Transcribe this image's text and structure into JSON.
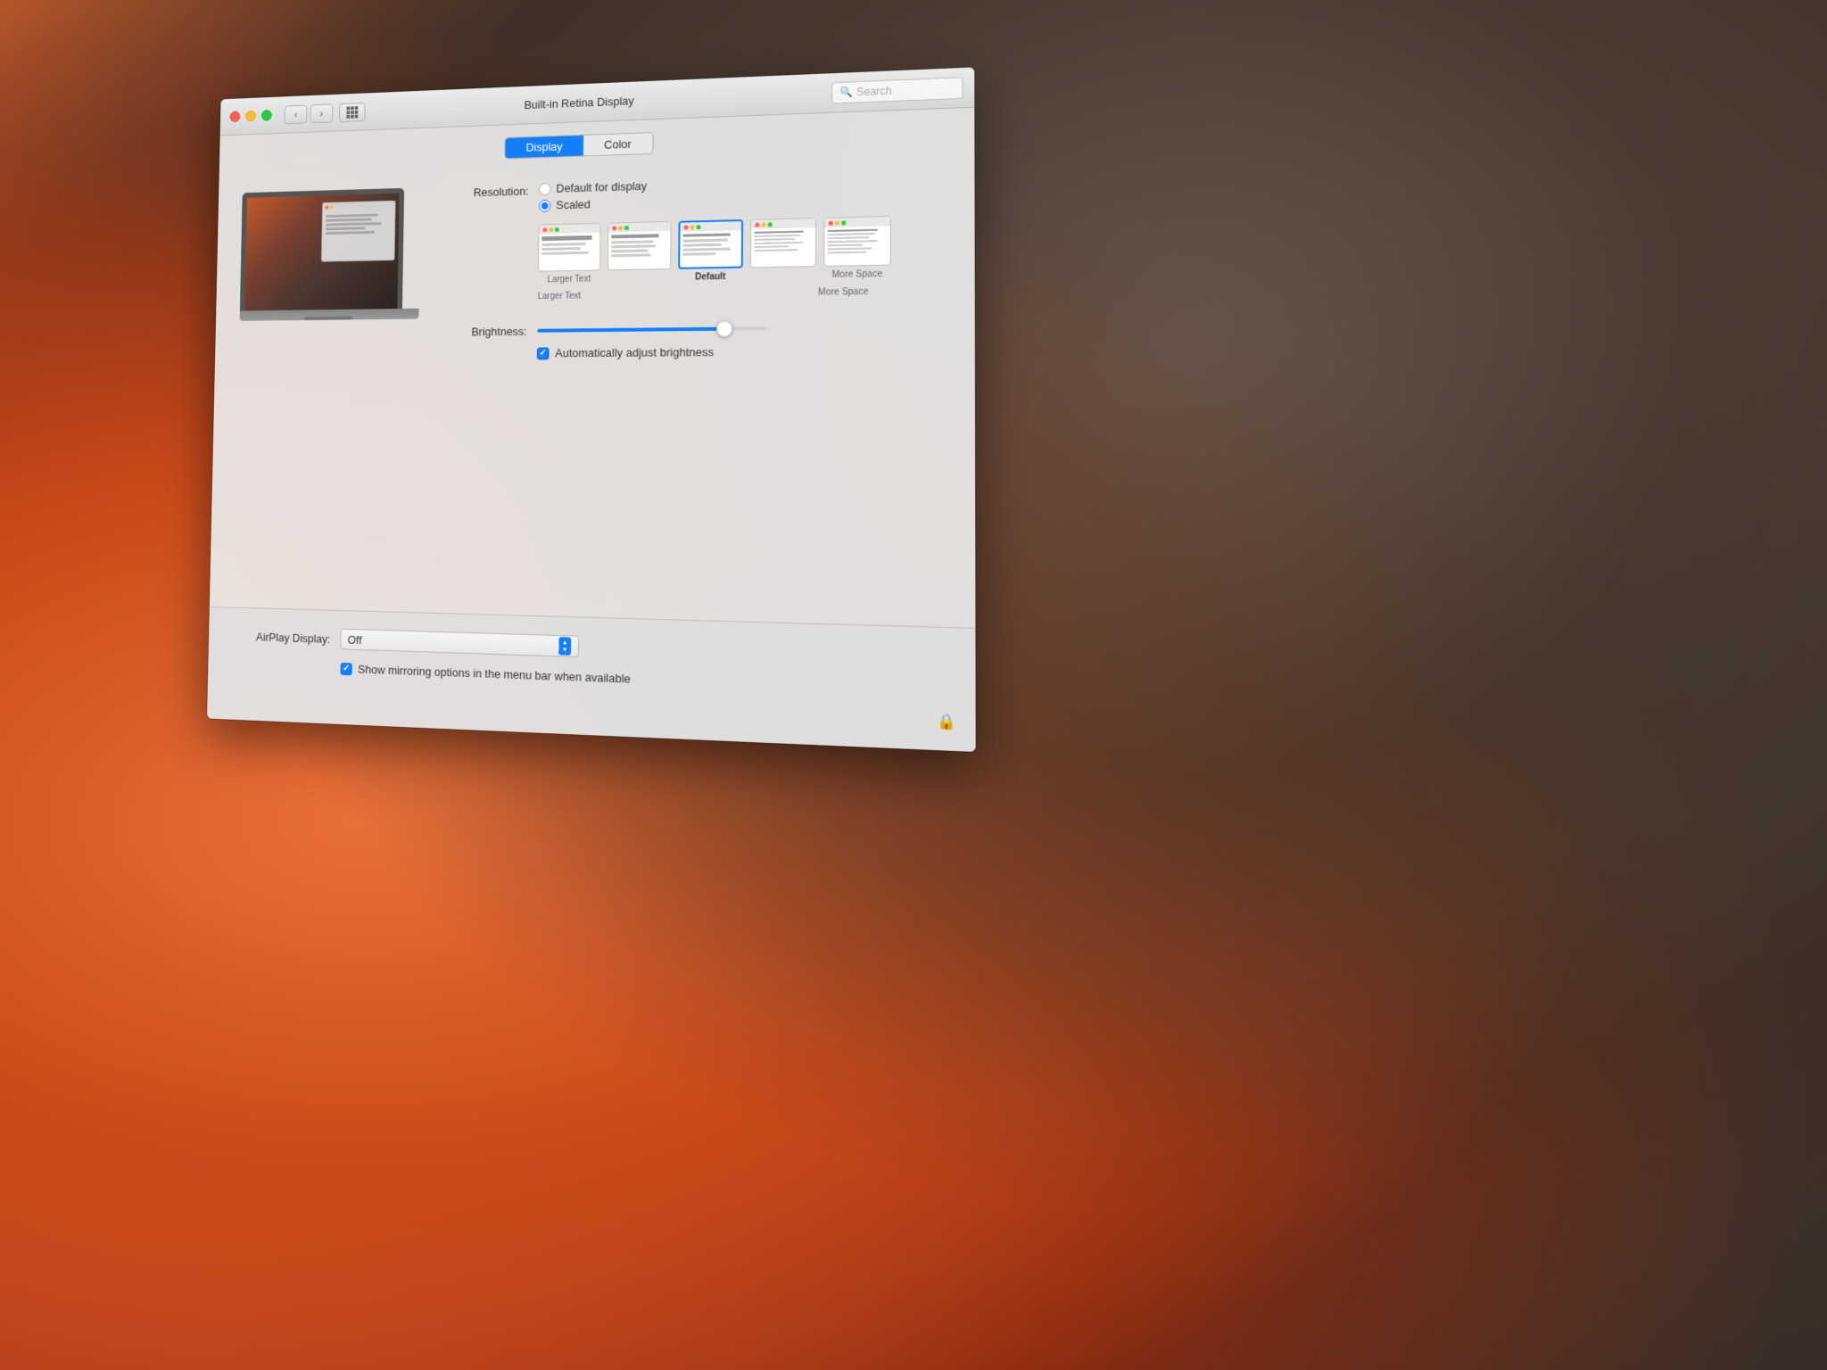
{
  "background": {
    "description": "macOS Yosemite El Capitan wallpaper"
  },
  "window": {
    "title": "Built-in Retina Display",
    "search_placeholder": "Search"
  },
  "tabs": {
    "items": [
      {
        "id": "display",
        "label": "Display",
        "active": true
      },
      {
        "id": "color",
        "label": "Color",
        "active": false
      }
    ]
  },
  "resolution": {
    "label": "Resolution:",
    "options": [
      {
        "id": "default",
        "label": "Default for display",
        "selected": false
      },
      {
        "id": "scaled",
        "label": "Scaled",
        "selected": true
      }
    ]
  },
  "scale_options": [
    {
      "id": "larger-text",
      "label": "Larger Text",
      "selected": false,
      "bold": false
    },
    {
      "id": "option2",
      "label": "",
      "selected": false,
      "bold": false
    },
    {
      "id": "default",
      "label": "Default",
      "selected": true,
      "bold": true
    },
    {
      "id": "option4",
      "label": "",
      "selected": false,
      "bold": false
    },
    {
      "id": "more-space",
      "label": "More Space",
      "selected": false,
      "bold": false
    }
  ],
  "scale_axis": {
    "left": "Larger Text",
    "right": "More Space"
  },
  "brightness": {
    "label": "Brightness:",
    "value": 85,
    "auto_adjust_label": "Automatically adjust brightness",
    "auto_adjust_checked": true
  },
  "airplay": {
    "label": "AirPlay Display:",
    "value": "Off"
  },
  "mirroring": {
    "label": "Show mirroring options in the menu bar when available",
    "checked": true
  },
  "icons": {
    "search": "🔍",
    "back": "‹",
    "forward": "›",
    "lock": "🔒",
    "checkmark": "✓"
  }
}
